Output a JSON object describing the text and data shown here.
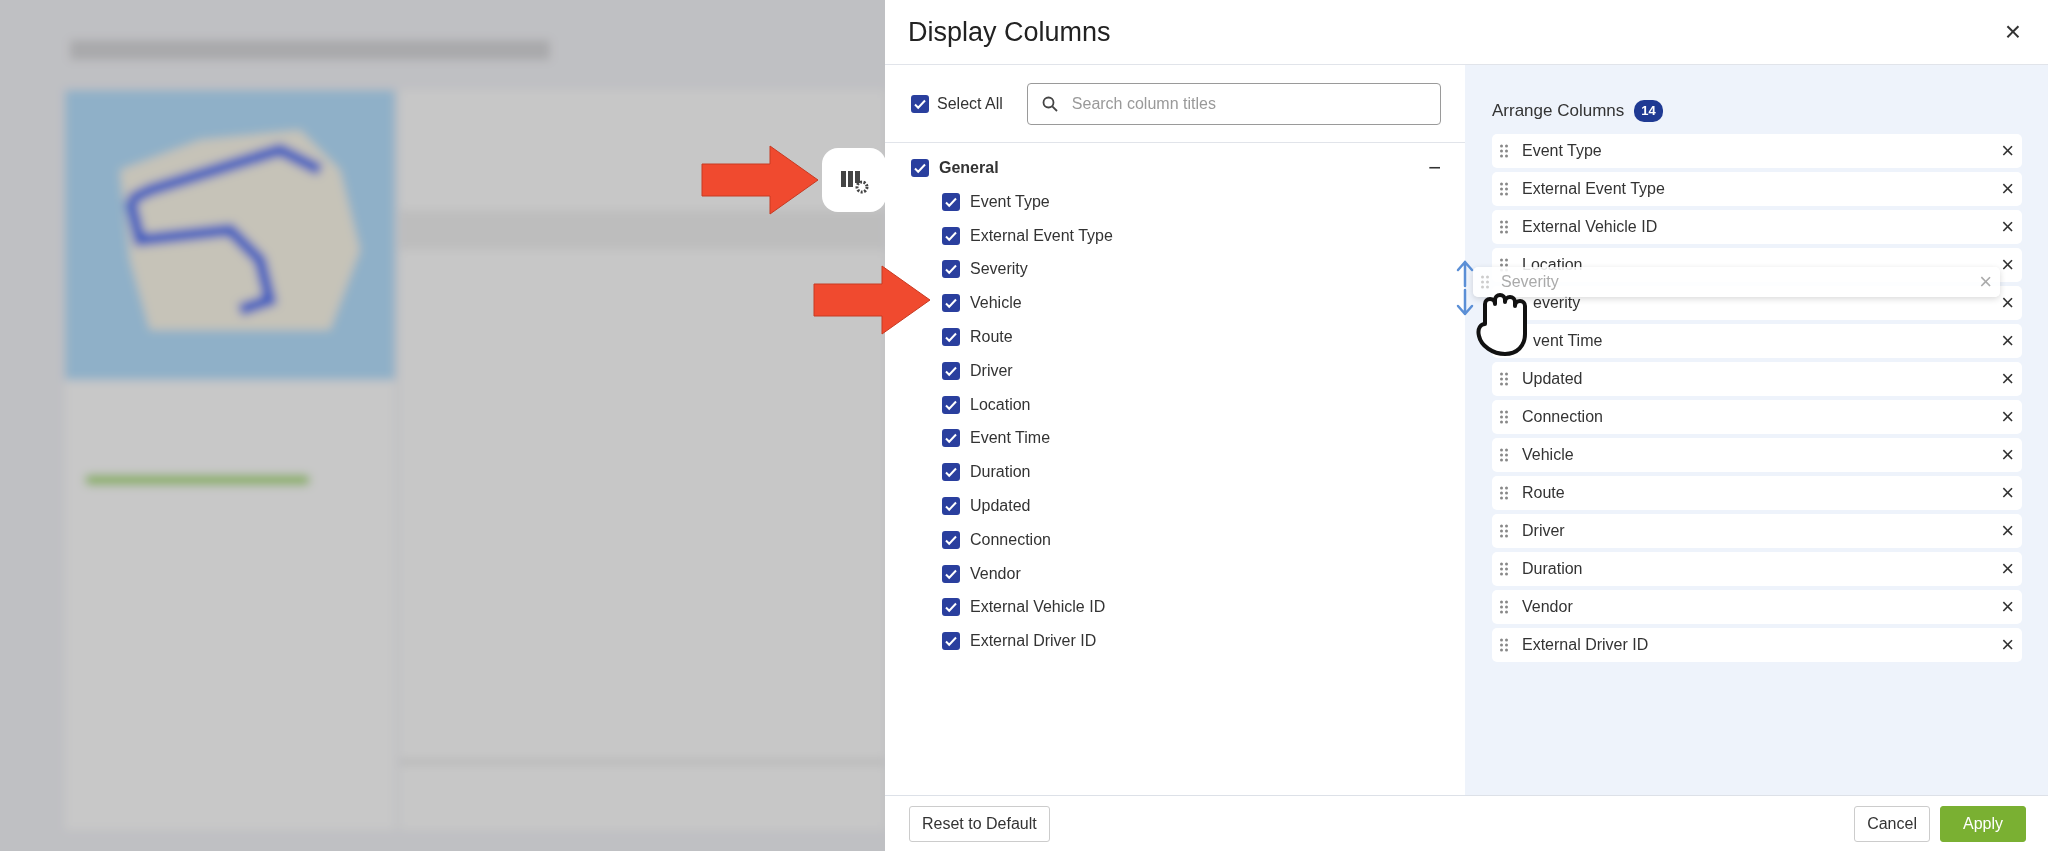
{
  "dialog": {
    "title": "Display Columns",
    "close": "×"
  },
  "select_all": {
    "label": "Select All",
    "checked": true
  },
  "search": {
    "placeholder": "Search column titles"
  },
  "group": {
    "label": "General",
    "checked": true,
    "expanded": true,
    "toggle": "−",
    "children": [
      {
        "label": "Event Type",
        "checked": true
      },
      {
        "label": "External Event Type",
        "checked": true
      },
      {
        "label": "Severity",
        "checked": true
      },
      {
        "label": "Vehicle",
        "checked": true
      },
      {
        "label": "Route",
        "checked": true
      },
      {
        "label": "Driver",
        "checked": true
      },
      {
        "label": "Location",
        "checked": true
      },
      {
        "label": "Event Time",
        "checked": true
      },
      {
        "label": "Duration",
        "checked": true
      },
      {
        "label": "Updated",
        "checked": true
      },
      {
        "label": "Connection",
        "checked": true
      },
      {
        "label": "Vendor",
        "checked": true
      },
      {
        "label": "External Vehicle ID",
        "checked": true
      },
      {
        "label": "External Driver ID",
        "checked": true
      }
    ]
  },
  "arrange": {
    "title": "Arrange Columns",
    "count": "14",
    "items": [
      {
        "label": "Event Type",
        "remove": "×"
      },
      {
        "label": "External Event Type",
        "remove": "×"
      },
      {
        "label": "External Vehicle ID",
        "remove": "×"
      },
      {
        "label": "Location",
        "remove": "×"
      },
      {
        "label": "everity",
        "remove": "×",
        "kind": "covered"
      },
      {
        "label": "vent Time",
        "remove": "×",
        "kind": "covered"
      },
      {
        "label": "Updated",
        "remove": "×"
      },
      {
        "label": "Connection",
        "remove": "×"
      },
      {
        "label": "Vehicle",
        "remove": "×"
      },
      {
        "label": "Route",
        "remove": "×"
      },
      {
        "label": "Driver",
        "remove": "×"
      },
      {
        "label": "Duration",
        "remove": "×"
      },
      {
        "label": "Vendor",
        "remove": "×"
      },
      {
        "label": "External Driver ID",
        "remove": "×"
      }
    ],
    "drag_ghost": {
      "label": "Severity",
      "remove": "×"
    }
  },
  "footer": {
    "reset": "Reset to Default",
    "cancel": "Cancel",
    "apply": "Apply"
  }
}
